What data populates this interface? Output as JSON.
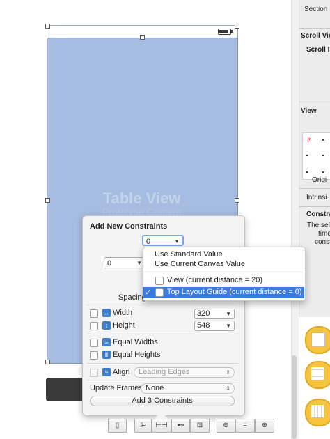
{
  "inspector": {
    "section_header": "Section H",
    "scroll_view": "Scroll Vie",
    "scroll_indicators": "Scroll In",
    "view": "View",
    "origin": "Origi",
    "intrinsic": "Intrinsi",
    "constraints": "Constra",
    "constraints_desc_1": "The sele",
    "constraints_desc_2": "time",
    "constraints_desc_3": "const"
  },
  "canvas": {
    "table_view_label": "Table View",
    "table_view_sublabel": "Prototype Content"
  },
  "popover": {
    "title": "Add New Constraints",
    "top_value": "0",
    "left_value": "0",
    "spacing_label": "Spacing",
    "width_label": "Width",
    "width_value": "320",
    "height_label": "Height",
    "height_value": "548",
    "equal_widths_label": "Equal Widths",
    "equal_heights_label": "Equal Heights",
    "align_label": "Align",
    "align_value": "Leading Edges",
    "update_frames_label": "Update Frames",
    "update_frames_value": "None",
    "add_button_label": "Add 3 Constraints"
  },
  "menu": {
    "items": [
      {
        "label": "Use Standard Value",
        "checked": false,
        "highlighted": false
      },
      {
        "label": "Use Current Canvas Value",
        "checked": false,
        "highlighted": false
      },
      {
        "label": "View (current distance = 20)",
        "checked": false,
        "highlighted": false
      },
      {
        "label": "Top Layout Guide (current distance = 0)",
        "checked": true,
        "highlighted": true
      }
    ],
    "checkmark": "✓"
  },
  "toolbar": {
    "buttons": [
      "device-icon",
      "align-icon",
      "pin-icon",
      "resolve-icon",
      "resizing-icon",
      "zoom-out-icon",
      "zoom-actual-icon",
      "zoom-in-icon"
    ]
  },
  "colors": {
    "table_view": "#a6bde1",
    "highlight": "#3a7be0",
    "library_icon": "#f5c542"
  }
}
